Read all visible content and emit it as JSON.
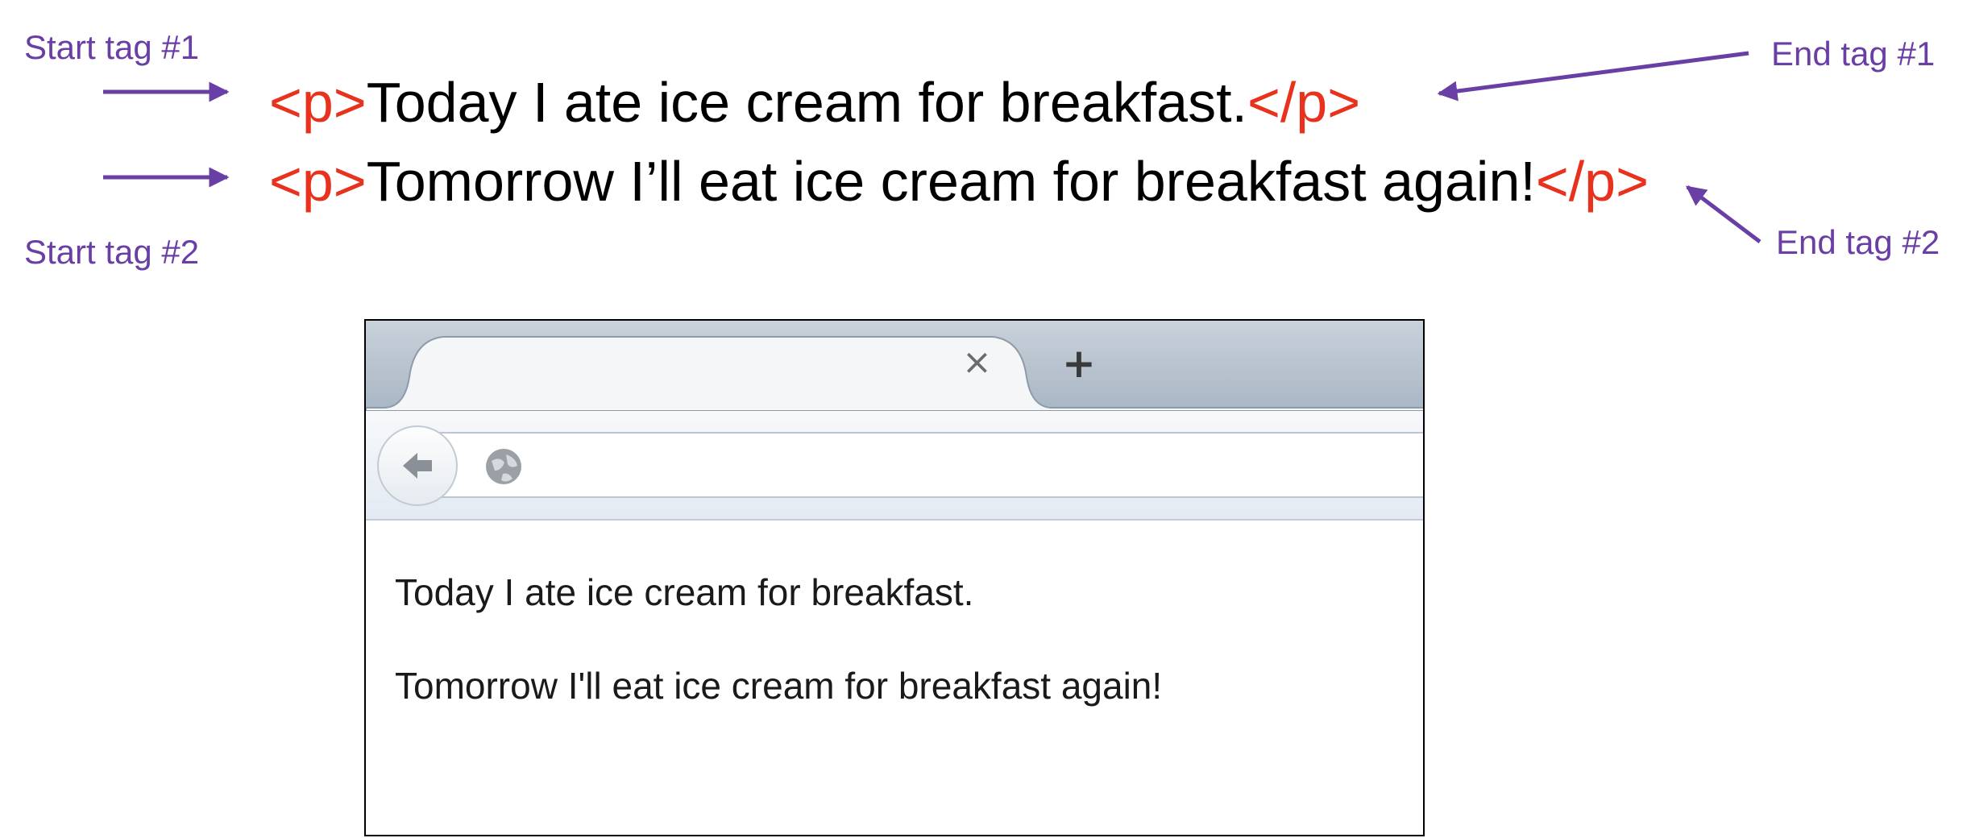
{
  "annotations": {
    "start_tag_1": "Start tag #1",
    "start_tag_2": "Start tag #2",
    "end_tag_1": "End tag #1",
    "end_tag_2": "End tag #2"
  },
  "code": {
    "line1": {
      "open": "<p>",
      "text": "Today I ate ice cream for breakfast.",
      "close": "</p>"
    },
    "line2": {
      "open": "<p>",
      "text": "Tomorrow I’ll eat ice cream for breakfast again!",
      "close": "</p>"
    }
  },
  "browser": {
    "tab_close_icon": "×",
    "new_tab_icon": "+",
    "address_value": "",
    "paragraphs": [
      "Today I ate ice cream for breakfast.",
      "Tomorrow I'll eat ice cream for breakfast again!"
    ]
  },
  "colors": {
    "annotation": "#6a3fa5",
    "tag": "#e8321e",
    "text": "#000000"
  }
}
